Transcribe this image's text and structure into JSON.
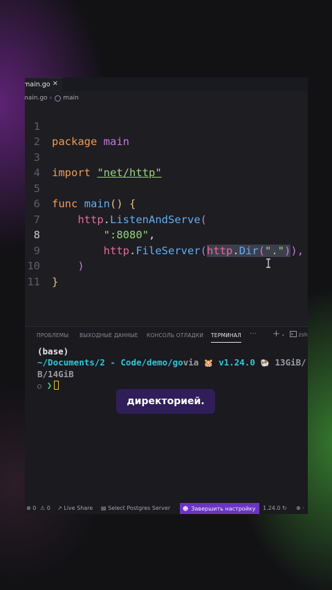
{
  "tab": {
    "label": "main.go",
    "close": "✕"
  },
  "breadcrumb": {
    "file": "main.go",
    "symbol": "main"
  },
  "editor": {
    "active_line": 8,
    "lines": [
      {
        "n": "1"
      },
      {
        "n": "2"
      },
      {
        "n": "3"
      },
      {
        "n": "4"
      },
      {
        "n": "5"
      },
      {
        "n": "6"
      },
      {
        "n": "7"
      },
      {
        "n": "8"
      },
      {
        "n": "9"
      },
      {
        "n": "10"
      },
      {
        "n": "11"
      }
    ],
    "tokens": {
      "package": "package",
      "main": "main",
      "import": "import",
      "import_path": "\"net/http\"",
      "func": "func",
      "func_name": "main",
      "func_sig": "() {",
      "http1": "http",
      "listen": "ListenAndServe",
      "open_paren": "(",
      "port": "\":8080\"",
      "comma": ",",
      "http2": "http",
      "fileserver": "FileServer",
      "http3": "http",
      "dir": "Dir",
      "dot": "\".\"",
      "close_parens": "),",
      "close_call": ")",
      "close_brace": "}"
    }
  },
  "panel": {
    "tabs": [
      "ПРОБЛЕМЫ",
      "ВЫХОДНЫЕ ДАННЫЕ",
      "КОНСОЛЬ ОТЛАДКИ",
      "ТЕРМИНАЛ"
    ],
    "active_tab": "ТЕРМИНАЛ",
    "more": "···",
    "add": "+",
    "shell": "zsh"
  },
  "terminal": {
    "env": "(base)",
    "path": "~/Documents/2 - Code/demo/go",
    "via": "via",
    "go_emoji": "🐹",
    "go_version": "v1.24.0",
    "mem_emoji": "🐏",
    "mem_line1": "13GiB/",
    "mem_line2": "B/14GiB",
    "prompt_dot": "○",
    "prompt_arrow": "❯"
  },
  "status": {
    "errors": "⊗ 0",
    "warnings": "⚠ 0",
    "live_share": "Live Share",
    "postgres": "Select Postgres Server",
    "finish_setup": "Завершить настройку",
    "go_version": "1.24.0"
  },
  "caption": "директорией."
}
